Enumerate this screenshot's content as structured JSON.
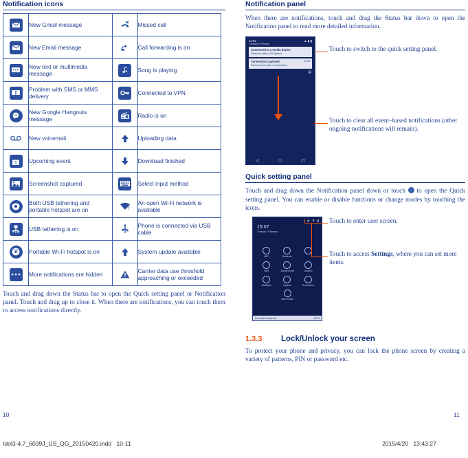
{
  "left": {
    "section_title": "Notification icons",
    "rows": [
      {
        "icon1": "gmail-icon",
        "text1": "New Gmail message",
        "icon2": "missed-call-icon",
        "text2": "Missed call"
      },
      {
        "icon1": "email-icon",
        "text1": "New Email message",
        "icon2": "call-forwarding-icon",
        "text2": "Call forwarding is on"
      },
      {
        "icon1": "sms-icon",
        "text1": "New text or multimedia message",
        "icon2": "music-icon",
        "text2": "Song is playing"
      },
      {
        "icon1": "warning-message-icon",
        "text1": "Problem with SMS or MMS delivery",
        "icon2": "vpn-key-icon",
        "text2": "Connected to VPN"
      },
      {
        "icon1": "hangouts-icon",
        "text1": "New Google Hangouts message",
        "icon2": "radio-icon",
        "text2": "Radio is on"
      },
      {
        "icon1": "voicemail-icon",
        "text1": "New voicemail",
        "icon2": "upload-arrow-icon",
        "text2": "Uploading data"
      },
      {
        "icon1": "calendar-icon",
        "text1": "Upcoming event",
        "icon2": "download-arrow-icon",
        "text2": "Download finished"
      },
      {
        "icon1": "screenshot-icon",
        "text1": "Screenshot captured",
        "icon2": "keyboard-icon",
        "text2": "Select input method"
      },
      {
        "icon1": "usb-tethering-hotspot-icon",
        "text1": "Both USB tethering and portable hotspot are on",
        "icon2": "wifi-question-icon",
        "text2": "An open Wi-Fi network is available"
      },
      {
        "icon1": "usb-tethering-icon",
        "text1": "USB tethering is on",
        "icon2": "usb-cable-icon",
        "text2": "Phone is connected via USB cable"
      },
      {
        "icon1": "portable-hotspot-icon",
        "text1": "Portable Wi-Fi hotspot is on",
        "icon2": "system-update-icon",
        "text2": "System update available"
      },
      {
        "icon1": "more-notifications-icon",
        "text1": "More notifications are hidden",
        "icon2": "carrier-data-warning-icon",
        "text2": "Carrier data use threshold approaching or exceeded"
      }
    ],
    "closing_paragraph": "Touch and drag down the Status bar to open the Quick setting panel or Notification panel. Touch and drag up to close it. When there are notifications, you can touch them to access notifications directly."
  },
  "right": {
    "notification_panel": {
      "title": "Notification panel",
      "intro": "When there are notifications, touch and drag the Status bar down to open the Notification panel to read more detailed information.",
      "callout_top": "Touch to switch to the quick setting panel.",
      "callout_bottom": "Touch to clear all event–based notifications (other ongoing notifications will remain).",
      "phone": {
        "status_time": "11:06",
        "status_date": "Tuesday 8 February",
        "status_icons": "▲ ▮ ▮",
        "card1_title": "Connected to a media device",
        "card1_sub": "Touch for video / OS options",
        "card2_title": "Screenshot captured",
        "card2_sub": "Touch to view, just or screenshot",
        "card2_time": "11:05"
      }
    },
    "quick_setting_panel": {
      "title": "Quick setting panel",
      "intro_1": "Touch and drag down the Notification panel down or touch",
      "intro_icon": "quick-setting-icon",
      "intro_2": "to open the Quick setting panel. You can enable or disable functions or change modes by touching the icons.",
      "callout_top": "Touch to enter user screen.",
      "callout_bottom_1": "Touch to access ",
      "callout_bottom_bold": "Settings",
      "callout_bottom_2": ", where you can set more items.",
      "phone": {
        "time": "15:07",
        "date": "Tuesday 8 February",
        "tiles": [
          {
            "label": "WIFI"
          },
          {
            "label": "Bluetooth"
          },
          {
            "label": ""
          },
          {
            "label": "SMS"
          },
          {
            "label": "Vibrate mode"
          },
          {
            "label": "Location"
          },
          {
            "label": "Flashlight"
          },
          {
            "label": "Capture"
          },
          {
            "label": "Screenshot"
          },
          {
            "label": "Auto Rotate"
          }
        ],
        "bottom_text": "Screenshot captured",
        "bottom_time": "15:06"
      }
    },
    "lock_section": {
      "number": "1.3.3",
      "title": "Lock/Unlock your screen",
      "body": "To protect your phone and privacy, you can lock the phone screen by creating a variety of patterns, PIN or password etc."
    }
  },
  "footer": {
    "page_left": "10",
    "page_right": "11",
    "file_line": "Idol3-4.7_6039J_US_QG_20150420.indd   10-11",
    "date_line": "2015/4/20   13:43:27"
  },
  "colors": {
    "accent_blue": "#1f3f8f",
    "accent_orange": "#e8520f",
    "border_blue": "#3a5fae",
    "icon_fill": "#2b4f9e"
  }
}
